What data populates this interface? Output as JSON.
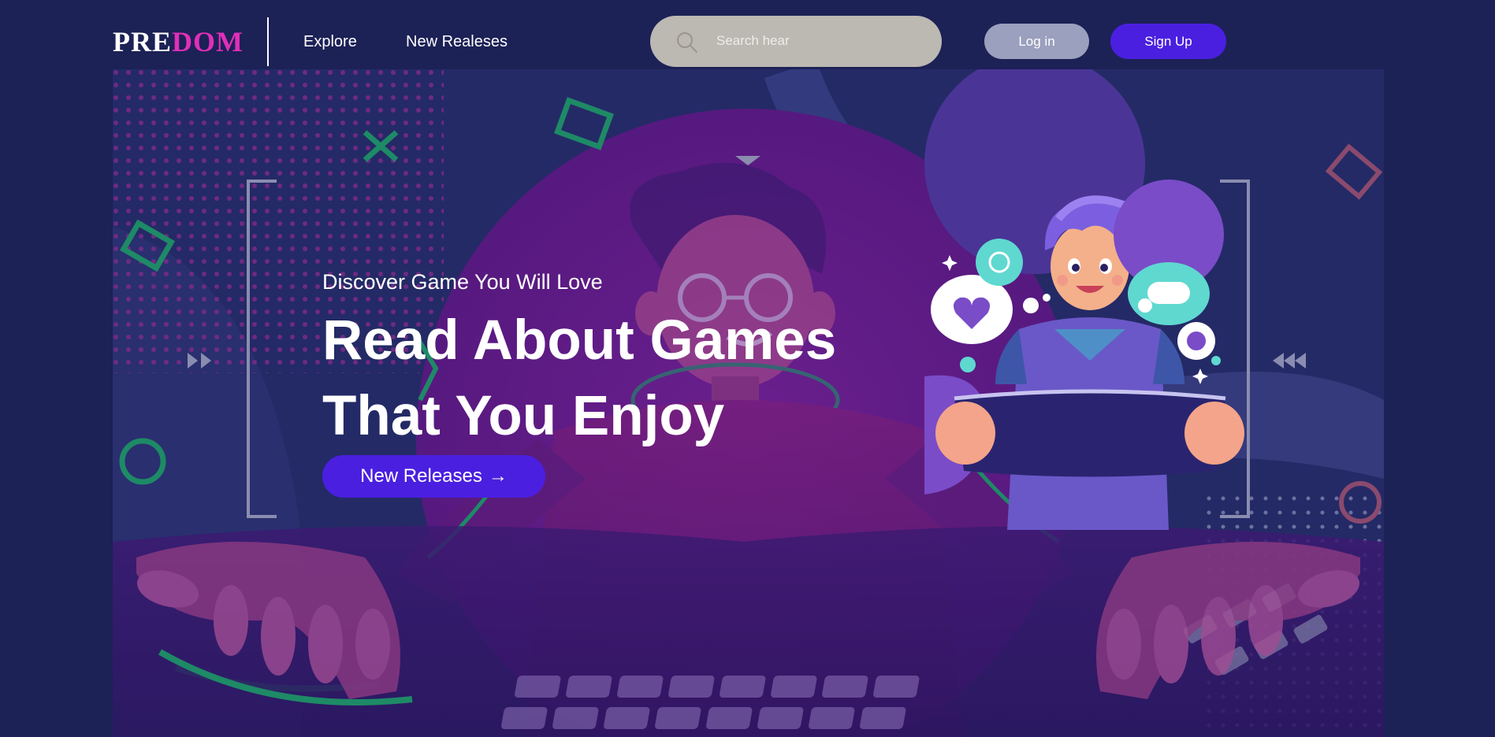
{
  "header": {
    "logo_part1": "PRE",
    "logo_part2": "DOM",
    "nav": {
      "explore": "Explore",
      "new_releases": "New Realeses"
    },
    "search_placeholder": "Search hear",
    "login_label": "Log in",
    "signup_label": "Sign Up"
  },
  "hero": {
    "subtitle": "Discover Game You Will Love",
    "headline_line1": "Read About Games",
    "headline_line2": "That You Enjoy",
    "cta_label": "New Releases",
    "cta_arrow": "→"
  },
  "colors": {
    "background": "#1c2156",
    "accent": "#4a1fe0",
    "logo_accent": "#e02fb8",
    "login_button": "#9aa0bd",
    "search_bg": "#bcb8b2"
  },
  "icons": [
    "search-icon",
    "arrow-right-icon"
  ]
}
